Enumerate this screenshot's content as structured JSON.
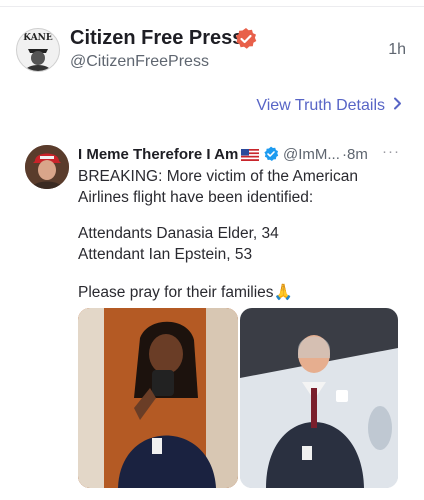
{
  "post": {
    "author_name": "Citizen Free Press",
    "author_handle": "@CitizenFreePress",
    "avatar_text": "KANE",
    "time": "1h",
    "view_details_label": "View Truth Details",
    "quoted": {
      "author_name": "I Meme Therefore I Am",
      "author_handle": "@ImM...",
      "separator": "·",
      "time": "8m",
      "more_icon": "···",
      "text_lines": [
        "BREAKING: More victim of the American",
        "Airlines flight have been identified:",
        "Attendants Danasia Elder, 34",
        "Attendant Ian Epstein, 53",
        "Please pray for their families🙏"
      ]
    }
  },
  "colors": {
    "verified_orange": "#e8604a",
    "verified_blue": "#1d9bf0",
    "link": "#5865c6",
    "secondary_text": "#5f6670"
  },
  "icons": {
    "verified_main": "verified-badge-icon",
    "verified_quote": "verified-check-icon",
    "flag": "us-flag-icon",
    "chevron": "chevron-right-icon",
    "more": "more-icon"
  }
}
